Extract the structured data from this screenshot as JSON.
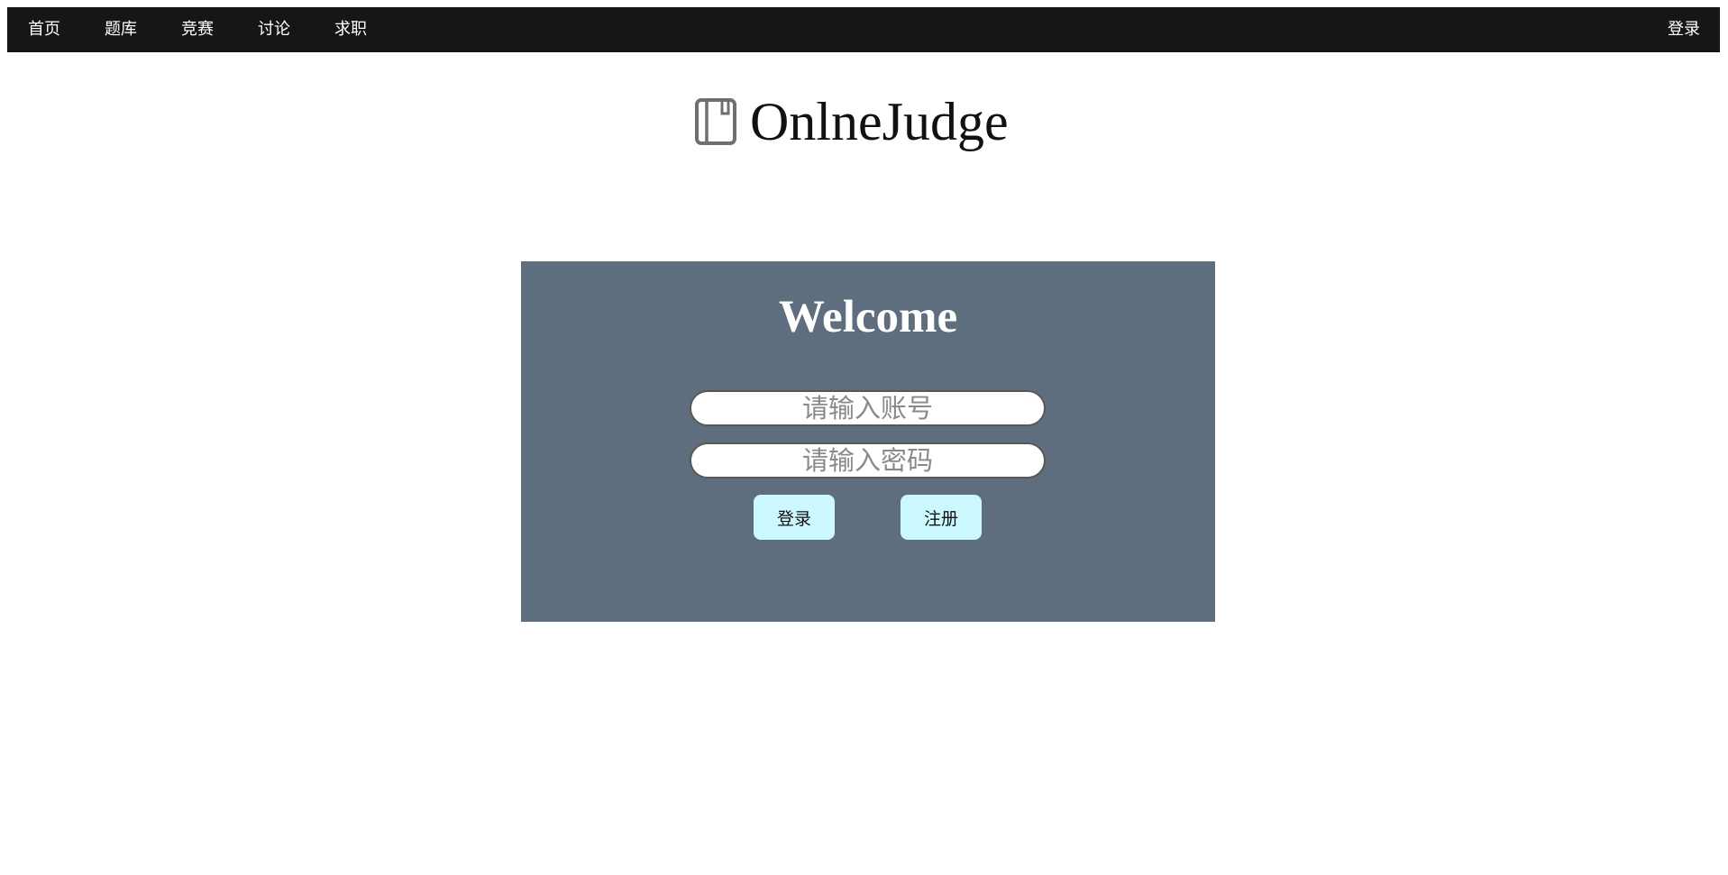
{
  "nav": {
    "items": [
      {
        "label": "首页"
      },
      {
        "label": "题库"
      },
      {
        "label": "竞赛"
      },
      {
        "label": "讨论"
      },
      {
        "label": "求职"
      }
    ],
    "login_label": "登录"
  },
  "brand": {
    "icon": "book-icon",
    "title": "OnlneJudge"
  },
  "login_card": {
    "heading": "Welcome",
    "account_placeholder": "请输入账号",
    "password_placeholder": "请输入密码",
    "login_button": "登录",
    "register_button": "注册"
  },
  "colors": {
    "topbar": "#151717",
    "card": "#5f6e7e",
    "button": "#ccf8ff"
  }
}
